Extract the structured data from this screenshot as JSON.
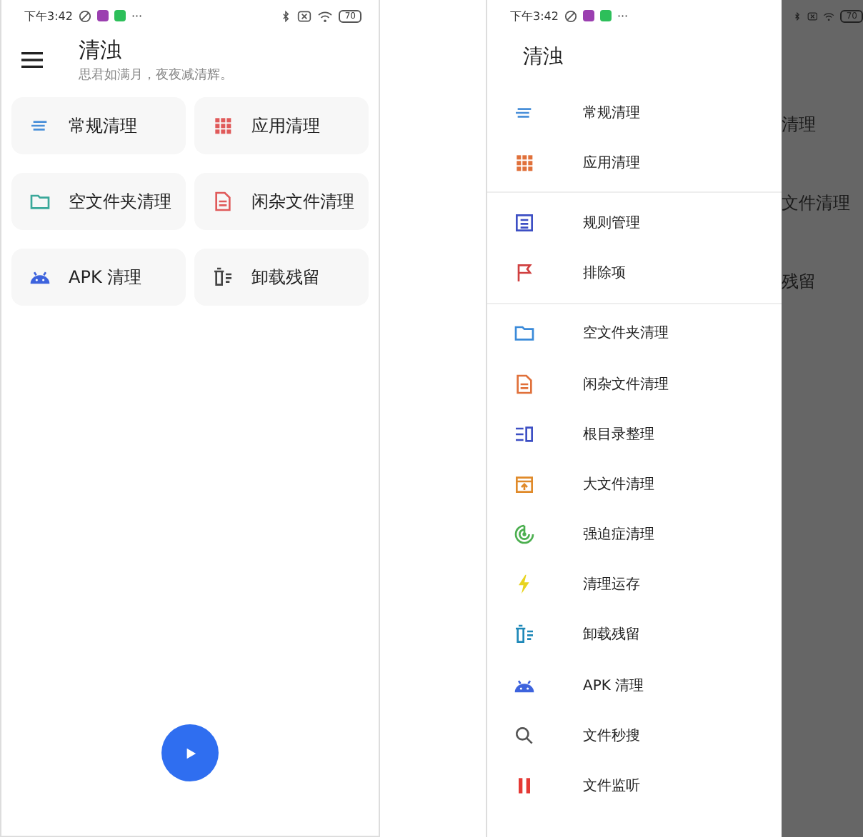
{
  "status_bar": {
    "time": "下午3:42",
    "more": "···",
    "battery": "70"
  },
  "main": {
    "title": "清浊",
    "subtitle": "思君如满月，夜夜减清辉。",
    "cards": [
      {
        "label": "常规清理"
      },
      {
        "label": "应用清理"
      },
      {
        "label": "空文件夹清理"
      },
      {
        "label": "闲杂文件清理"
      },
      {
        "label": "APK 清理"
      },
      {
        "label": "卸载残留"
      }
    ]
  },
  "drawer": {
    "status_bar": {
      "time": "下午3:42",
      "more": "···",
      "battery": "70"
    },
    "title": "清浊",
    "sections": [
      [
        {
          "label": "常规清理"
        },
        {
          "label": "应用清理"
        }
      ],
      [
        {
          "label": "规则管理"
        },
        {
          "label": "排除项"
        }
      ],
      [
        {
          "label": "空文件夹清理"
        },
        {
          "label": "闲杂文件清理"
        },
        {
          "label": "根目录整理"
        },
        {
          "label": "大文件清理"
        },
        {
          "label": "强迫症清理"
        },
        {
          "label": "清理运存"
        },
        {
          "label": "卸载残留"
        },
        {
          "label": "APK 清理"
        },
        {
          "label": "文件秒搜"
        },
        {
          "label": "文件监听"
        }
      ]
    ]
  },
  "behind_drawer": [
    "清理",
    "文件清理",
    "残留"
  ]
}
